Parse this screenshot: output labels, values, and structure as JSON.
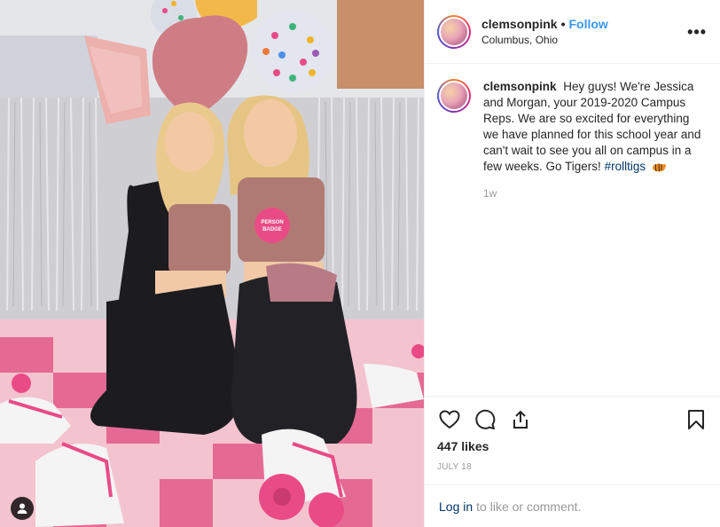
{
  "post": {
    "username": "clemsonpink",
    "follow_label": "Follow",
    "separator": "•",
    "location": "Columbus, Ohio",
    "more_label": "•••"
  },
  "caption": {
    "username": "clemsonpink",
    "text": "Hey guys! We're Jessica and Morgan, your 2019-2020 Campus Reps. We are so excited for everything we have planned for this school year and can't wait to see you all on campus in a few weeks. Go Tigers!",
    "hashtag": "#rolltigs",
    "emoji": "tiger-emoji",
    "time_ago": "1w"
  },
  "actions": {
    "likes": "447 likes",
    "date": "JULY 18",
    "icons": [
      "heart-icon",
      "comment-icon",
      "share-icon",
      "bookmark-icon"
    ]
  },
  "login": {
    "link": "Log in",
    "rest": "to like or comment."
  },
  "photo": {
    "badge_text": "PERSON\nBADGE",
    "colors": {
      "pink": "#e94b86",
      "accent": "#3897f0"
    }
  }
}
